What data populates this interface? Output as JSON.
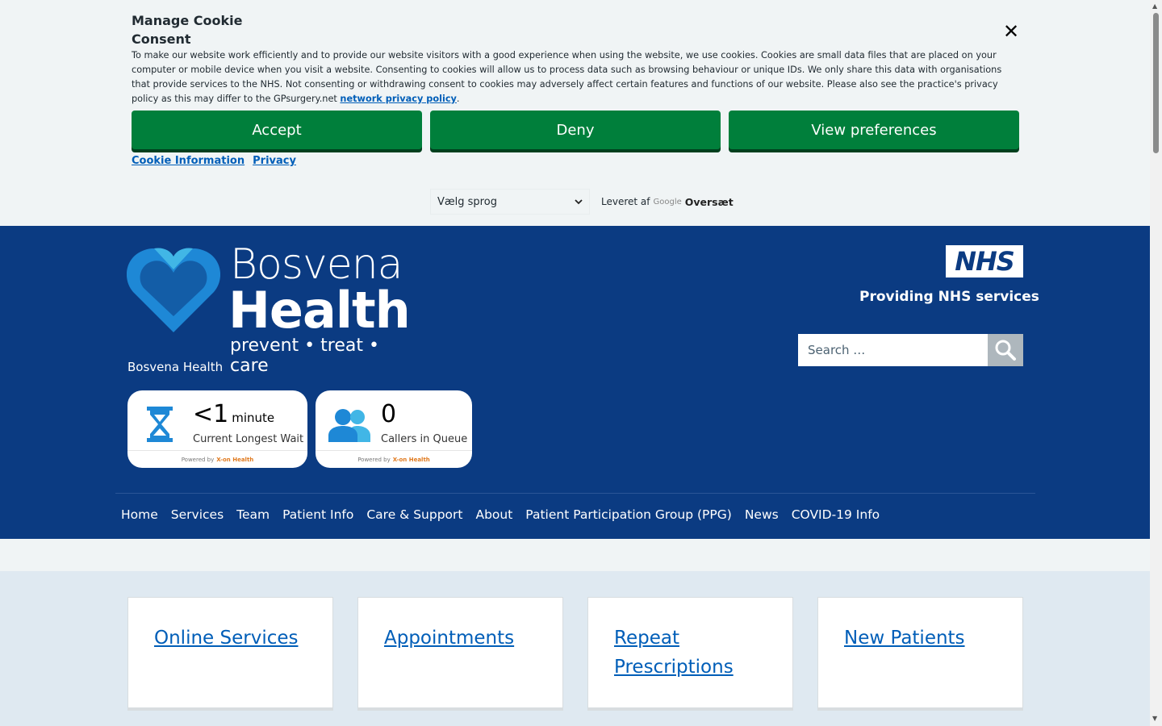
{
  "cookie": {
    "title": "Manage Cookie Consent",
    "close": "✕",
    "text_before": "To make our website work efficiently and to provide our website visitors with a good experience when using the website, we use cookies. Cookies are small data files that are placed on your computer or mobile device when you visit a website. Consenting to cookies will allow us to process data such as browsing behaviour or unique IDs. We only share this data with organisations that provide services to the NHS. Not consenting or withdrawing consent to cookies may adversely affect certain features and functions of our website. Please also see the practice's privacy policy as this may differ to the GPsurgery.net ",
    "policy_link": "network privacy policy",
    "text_after": ".",
    "buttons": {
      "accept": "Accept",
      "deny": "Deny",
      "preferences": "View preferences"
    },
    "links": {
      "cookie_info": "Cookie Information",
      "privacy": "Privacy"
    }
  },
  "translate": {
    "select_value": "Vælg sprog",
    "powered_by": "Leveret af",
    "google": "Google",
    "translate": "Oversæt"
  },
  "header": {
    "logo": {
      "line1": "Bosvena",
      "line2": "Health",
      "line3": "prevent • treat • care"
    },
    "site_name": "Bosvena Health",
    "nhs_logo": "NHS",
    "nhs_sub": "Providing NHS services",
    "search_placeholder": "Search …"
  },
  "widgets": [
    {
      "value": "<1",
      "unit": "minute",
      "caption": "Current Longest Wait",
      "powered": "Powered by",
      "brand": "X-on Health",
      "icon": "hourglass-icon"
    },
    {
      "value": "0",
      "unit": "",
      "caption": "Callers in Queue",
      "powered": "Powered by",
      "brand": "X-on Health",
      "icon": "people-icon"
    }
  ],
  "nav": [
    "Home",
    "Services",
    "Team",
    "Patient Info",
    "Care & Support",
    "About",
    "Patient Participation Group (PPG)",
    "News",
    "COVID-19 Info"
  ],
  "cards": [
    "Online Services",
    "Appointments",
    "Repeat Prescriptions",
    "New Patients"
  ],
  "colors": {
    "nhs_blue": "#0b3b82",
    "green": "#007f3b",
    "link": "#005eb8",
    "light_blue": "#41b6e6"
  }
}
